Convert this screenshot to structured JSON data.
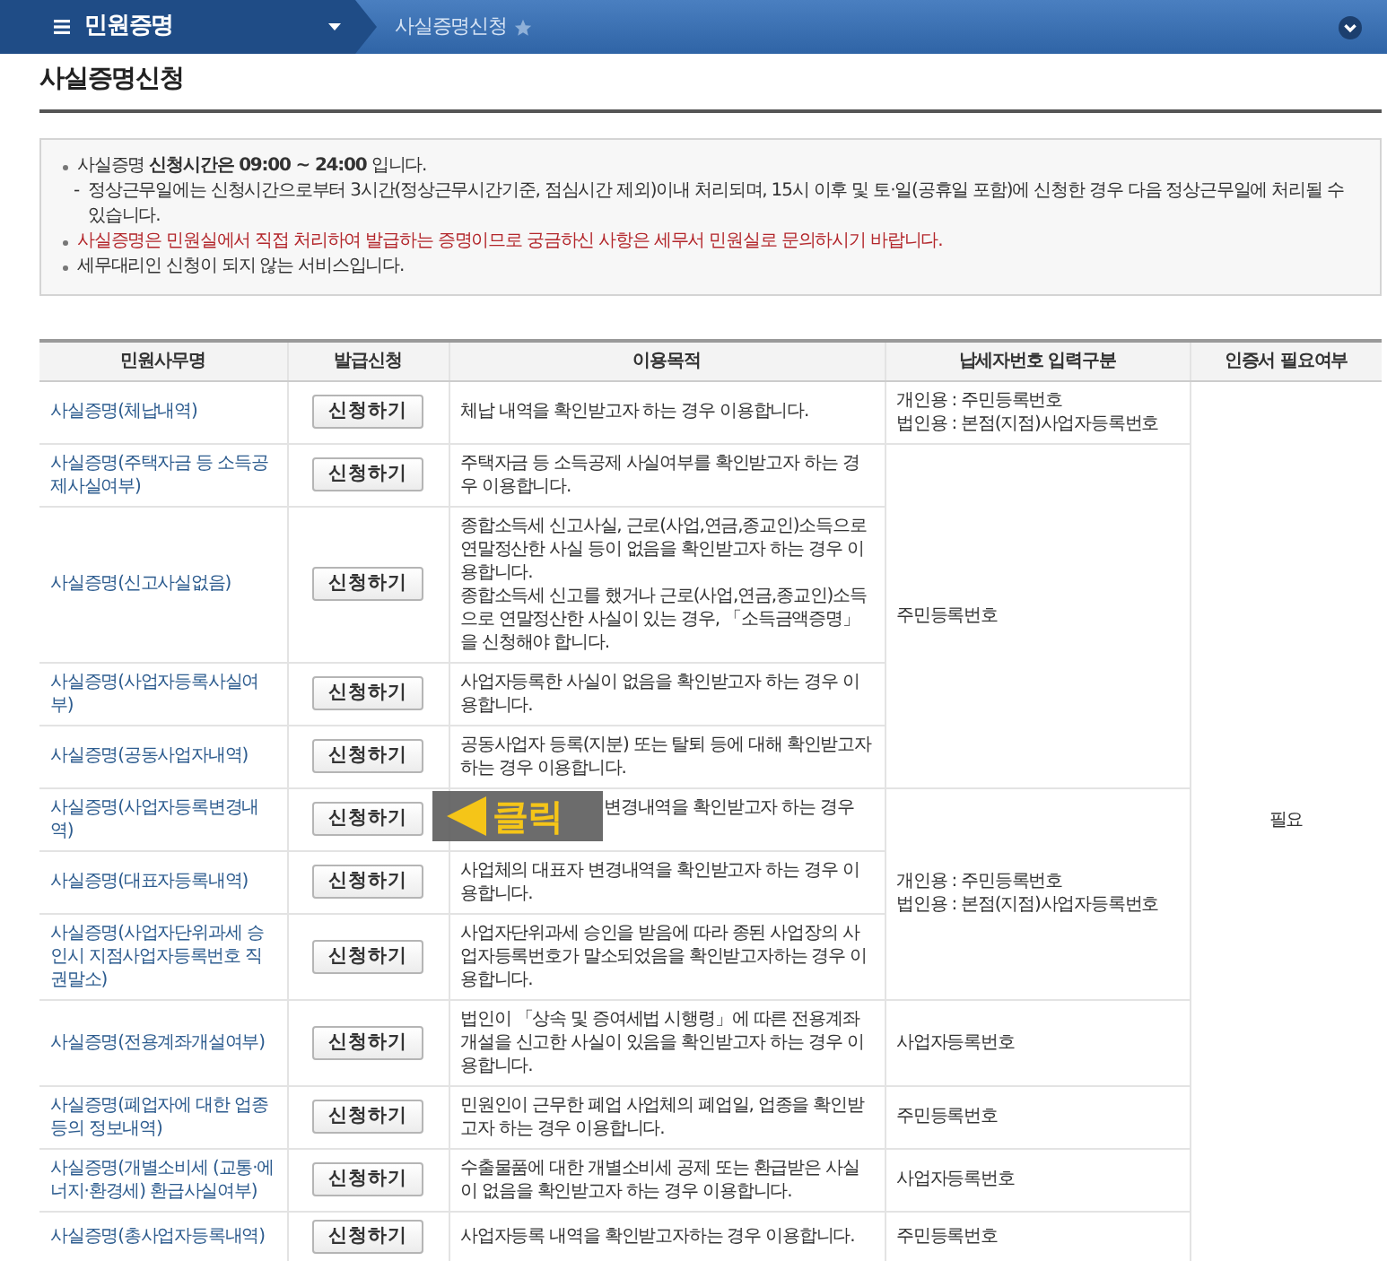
{
  "nav": {
    "menu_title": "민원증명",
    "breadcrumb": "사실증명신청"
  },
  "page_title": "사실증명신청",
  "notices": [
    {
      "kind": "bullet",
      "text": "사실증명 **신청시간은 09:00 ~ 24:00** 입니다."
    },
    {
      "kind": "sub",
      "marker": "-",
      "text": "정상근무일에는 신청시간으로부터 3시간(정상근무시간기준, 점심시간 제외)이내 처리되며, 15시 이후 및 토·일(공휴일 포함)에 신청한 경우 다음 정상근무일에 처리될 수 있습니다."
    },
    {
      "kind": "warning",
      "text": "사실증명은 민원실에서 직접 처리하여 발급하는 증명이므로 궁금하신 사항은 세무서 민원실로 문의하시기 바랍니다."
    },
    {
      "kind": "bullet",
      "text": "세무대리인 신청이 되지 않는 서비스입니다."
    }
  ],
  "table": {
    "columns": [
      "민원사무명",
      "발급신청",
      "이용목적",
      "납세자번호 입력구분",
      "인증서 필요여부"
    ],
    "certificate_required": "필요",
    "groups": [
      {
        "id_input": [
          "개인용 : 주민등록번호",
          "법인용 : 본점(지점)사업자등록번호"
        ],
        "rows": [
          {
            "name": "사실증명(체납내역)",
            "button": "신청하기",
            "purpose": [
              "체납 내역을 확인받고자 하는 경우 이용합니다."
            ]
          }
        ]
      },
      {
        "id_input": [
          "주민등록번호"
        ],
        "rows": [
          {
            "name": "사실증명(주택자금 등 소득공제사실여부)",
            "button": "신청하기",
            "purpose": [
              "주택자금 등 소득공제 사실여부를 확인받고자 하는 경우 이용합니다."
            ]
          },
          {
            "name": "사실증명(신고사실없음)",
            "button": "신청하기",
            "purpose": [
              "종합소득세 신고사실, 근로(사업,연금,종교인)소득으로 연말정산한 사실 등이 없음을 확인받고자 하는 경우 이용합니다.",
              "종합소득세 신고를 했거나 근로(사업,연금,종교인)소득으로 연말정산한 사실이 있는 경우, 「소득금액증명」을 신청해야 합니다."
            ]
          },
          {
            "name": "사실증명(사업자등록사실여부)",
            "button": "신청하기",
            "purpose": [
              "사업자등록한 사실이 없음을 확인받고자 하는 경우 이용합니다."
            ]
          },
          {
            "name": "사실증명(공동사업자내역)",
            "button": "신청하기",
            "purpose": [
              "공동사업자 등록(지분) 또는 탈퇴 등에 대해 확인받고자 하는 경우 이용합니다."
            ]
          }
        ]
      },
      {
        "id_input": [
          "개인용 : 주민등록번호",
          "법인용 : 본점(지점)사업자등록번호"
        ],
        "rows": [
          {
            "name": "사실증명(사업자등록변경내역)",
            "button": "신청하기",
            "purpose": [
              "변경내역을 확인받고자 하는 경우"
            ],
            "callout": "클릭"
          },
          {
            "name": "사실증명(대표자등록내역)",
            "button": "신청하기",
            "purpose": [
              "사업체의 대표자 변경내역을 확인받고자 하는 경우 이용합니다."
            ]
          },
          {
            "name": "사실증명(사업자단위과세 승인시 지점사업자등록번호 직권말소)",
            "button": "신청하기",
            "purpose": [
              "사업자단위과세 승인을 받음에 따라 종된 사업장의 사업자등록번호가 말소되었음을 확인받고자하는 경우 이용합니다."
            ]
          }
        ]
      },
      {
        "id_input": [
          "사업자등록번호"
        ],
        "rows": [
          {
            "name": "사실증명(전용계좌개설여부)",
            "button": "신청하기",
            "purpose": [
              "법인이 「상속 및 증여세법 시행령」에 따른 전용계좌 개설을 신고한 사실이 있음을 확인받고자 하는 경우 이용합니다."
            ]
          }
        ]
      },
      {
        "id_input": [
          "주민등록번호"
        ],
        "rows": [
          {
            "name": "사실증명(폐업자에 대한 업종등의 정보내역)",
            "button": "신청하기",
            "purpose": [
              "민원인이 근무한 폐업 사업체의 폐업일, 업종을 확인받고자 하는 경우 이용합니다."
            ]
          }
        ]
      },
      {
        "id_input": [
          "사업자등록번호"
        ],
        "rows": [
          {
            "name": "사실증명(개별소비세 (교통·에너지·환경세) 환급사실여부)",
            "button": "신청하기",
            "purpose": [
              "수출물품에 대한 개별소비세 공제 또는 환급받은 사실이 없음을 확인받고자 하는 경우 이용합니다."
            ]
          }
        ]
      },
      {
        "id_input": [
          "주민등록번호"
        ],
        "rows": [
          {
            "name": "사실증명(총사업자등록내역)",
            "button": "신청하기",
            "purpose": [
              "사업자등록 내역을 확인받고자하는 경우 이용합니다."
            ]
          }
        ]
      }
    ]
  }
}
